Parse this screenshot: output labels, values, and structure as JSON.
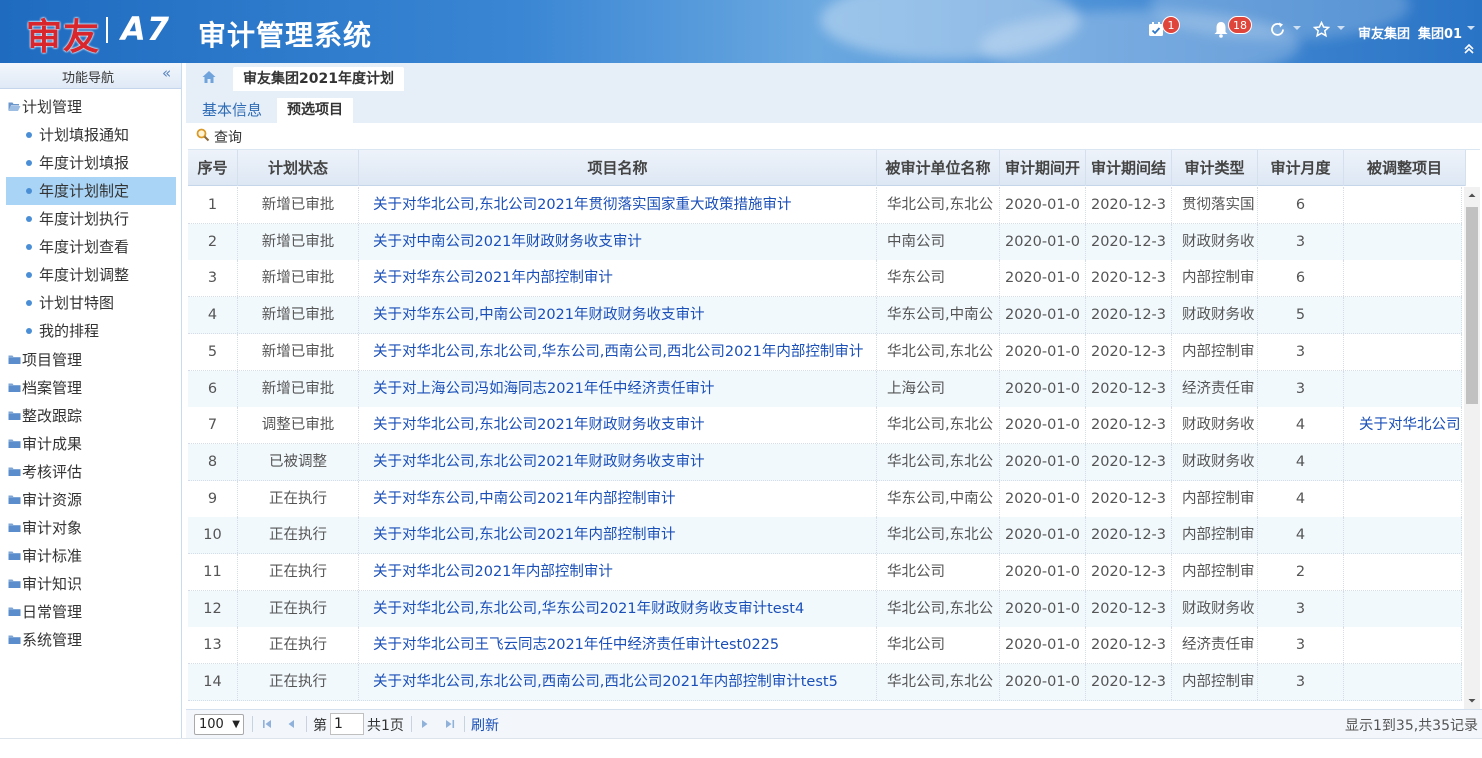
{
  "header": {
    "logo_text": "审友",
    "logo_product": "A7",
    "system_title": "审计管理系统",
    "calendar_badge": "1",
    "bell_badge": "18",
    "user_org": "审友集团",
    "user_name": "集团01"
  },
  "sidebar": {
    "title": "功能导航",
    "groups": [
      {
        "label": "计划管理"
      },
      {
        "label": "项目管理"
      },
      {
        "label": "档案管理"
      },
      {
        "label": "整改跟踪"
      },
      {
        "label": "审计成果"
      },
      {
        "label": "考核评估"
      },
      {
        "label": "审计资源"
      },
      {
        "label": "审计对象"
      },
      {
        "label": "审计标准"
      },
      {
        "label": "审计知识"
      },
      {
        "label": "日常管理"
      },
      {
        "label": "系统管理"
      }
    ],
    "plan_items": [
      {
        "label": "计划填报通知"
      },
      {
        "label": "年度计划填报"
      },
      {
        "label": "年度计划制定"
      },
      {
        "label": "年度计划执行"
      },
      {
        "label": "年度计划查看"
      },
      {
        "label": "年度计划调整"
      },
      {
        "label": "计划甘特图"
      },
      {
        "label": "我的排程"
      }
    ]
  },
  "breadcrumb": {
    "tab_label": "审友集团2021年度计划"
  },
  "tabs": {
    "basic_info": "基本信息",
    "preselect": "预选项目"
  },
  "toolbar": {
    "query_label": "查询"
  },
  "grid": {
    "columns": [
      "序号",
      "计划状态",
      "项目名称",
      "被审计单位名称",
      "审计期间开",
      "审计期间结",
      "审计类型",
      "审计月度",
      "被调整项目"
    ],
    "rows": [
      {
        "no": "1",
        "status": "新增已审批",
        "name": "关于对华北公司,东北公司2021年贯彻落实国家重大政策措施审计",
        "unit": "华北公司,东北公",
        "start": "2020-01-0",
        "end": "2020-12-3",
        "type": "贯彻落实国",
        "month": "6",
        "adjusted": ""
      },
      {
        "no": "2",
        "status": "新增已审批",
        "name": "关于对中南公司2021年财政财务收支审计",
        "unit": "中南公司",
        "start": "2020-01-0",
        "end": "2020-12-3",
        "type": "财政财务收",
        "month": "3",
        "adjusted": ""
      },
      {
        "no": "3",
        "status": "新增已审批",
        "name": "关于对华东公司2021年内部控制审计",
        "unit": "华东公司",
        "start": "2020-01-0",
        "end": "2020-12-3",
        "type": "内部控制审",
        "month": "6",
        "adjusted": ""
      },
      {
        "no": "4",
        "status": "新增已审批",
        "name": "关于对华东公司,中南公司2021年财政财务收支审计",
        "unit": "华东公司,中南公",
        "start": "2020-01-0",
        "end": "2020-12-3",
        "type": "财政财务收",
        "month": "5",
        "adjusted": ""
      },
      {
        "no": "5",
        "status": "新增已审批",
        "name": "关于对华北公司,东北公司,华东公司,西南公司,西北公司2021年内部控制审计",
        "unit": "华北公司,东北公",
        "start": "2020-01-0",
        "end": "2020-12-3",
        "type": "内部控制审",
        "month": "3",
        "adjusted": ""
      },
      {
        "no": "6",
        "status": "新增已审批",
        "name": "关于对上海公司冯如海同志2021年任中经济责任审计",
        "unit": "上海公司",
        "start": "2020-01-0",
        "end": "2020-12-3",
        "type": "经济责任审",
        "month": "3",
        "adjusted": ""
      },
      {
        "no": "7",
        "status": "调整已审批",
        "name": "关于对华北公司,东北公司2021年财政财务收支审计",
        "unit": "华北公司,东北公",
        "start": "2020-01-0",
        "end": "2020-12-3",
        "type": "财政财务收",
        "month": "4",
        "adjusted": "关于对华北公司"
      },
      {
        "no": "8",
        "status": "已被调整",
        "name": "关于对华北公司,东北公司2021年财政财务收支审计",
        "unit": "华北公司,东北公",
        "start": "2020-01-0",
        "end": "2020-12-3",
        "type": "财政财务收",
        "month": "4",
        "adjusted": ""
      },
      {
        "no": "9",
        "status": "正在执行",
        "name": "关于对华东公司,中南公司2021年内部控制审计",
        "unit": "华东公司,中南公",
        "start": "2020-01-0",
        "end": "2020-12-3",
        "type": "内部控制审",
        "month": "4",
        "adjusted": ""
      },
      {
        "no": "10",
        "status": "正在执行",
        "name": "关于对华北公司,东北公司2021年内部控制审计",
        "unit": "华北公司,东北公",
        "start": "2020-01-0",
        "end": "2020-12-3",
        "type": "内部控制审",
        "month": "4",
        "adjusted": ""
      },
      {
        "no": "11",
        "status": "正在执行",
        "name": "关于对华北公司2021年内部控制审计",
        "unit": "华北公司",
        "start": "2020-01-0",
        "end": "2020-12-3",
        "type": "内部控制审",
        "month": "2",
        "adjusted": ""
      },
      {
        "no": "12",
        "status": "正在执行",
        "name": "关于对华北公司,东北公司,华东公司2021年财政财务收支审计test4",
        "unit": "华北公司,东北公",
        "start": "2020-01-0",
        "end": "2020-12-3",
        "type": "财政财务收",
        "month": "3",
        "adjusted": ""
      },
      {
        "no": "13",
        "status": "正在执行",
        "name": "关于对华北公司王飞云同志2021年任中经济责任审计test0225",
        "unit": "华北公司",
        "start": "2020-01-0",
        "end": "2020-12-3",
        "type": "经济责任审",
        "month": "3",
        "adjusted": ""
      },
      {
        "no": "14",
        "status": "正在执行",
        "name": "关于对华北公司,东北公司,西南公司,西北公司2021年内部控制审计test5",
        "unit": "华北公司,东北公",
        "start": "2020-01-0",
        "end": "2020-12-3",
        "type": "内部控制审",
        "month": "3",
        "adjusted": ""
      }
    ]
  },
  "pager": {
    "page_size": "100",
    "page_prefix": "第",
    "page_value": "1",
    "page_total": "共1页",
    "refresh": "刷新",
    "summary": "显示1到35,共35记录"
  }
}
